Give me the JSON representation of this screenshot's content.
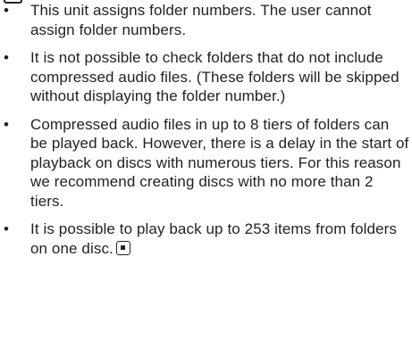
{
  "bullets": [
    {
      "marker": "•",
      "text": "This unit assigns folder numbers. The user cannot assign folder numbers."
    },
    {
      "marker": "•",
      "text": "It is not possible to check folders that do not include compressed audio files. (These folders will be skipped without displaying the folder number.)"
    },
    {
      "marker": "•",
      "text": "Compressed audio files in up to 8 tiers of folders can be played back. However, there is a delay in the start of playback on discs with numerous tiers. For this reason we recom­mend creating discs with no more than 2 tiers."
    },
    {
      "marker": "•",
      "text": "It is possible to play back up to 253 items from folders on one disc."
    }
  ],
  "icons": {
    "end_of_section": "stop-square-icon"
  }
}
